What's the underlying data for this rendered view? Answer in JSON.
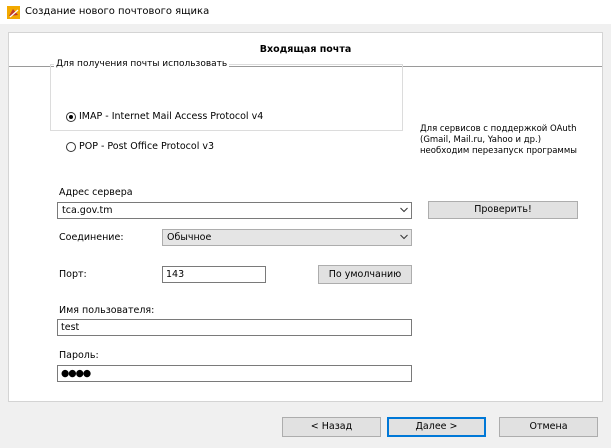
{
  "window": {
    "title": "Создание нового почтового ящика"
  },
  "page": {
    "title": "Входящая почта"
  },
  "protocol_group": {
    "legend": "Для получения почты использовать",
    "options": [
      {
        "label": "IMAP - Internet Mail Access Protocol v4",
        "selected": true
      },
      {
        "label": "POP  -  Post Office Protocol v3",
        "selected": false
      }
    ]
  },
  "oauth": {
    "note": "Для сервисов с поддержкой OAuth (Gmail, Mail.ru, Yahoo и др.) необходим перезапуск программы",
    "check_label": "Проверить!"
  },
  "server": {
    "label": "Адрес сервера",
    "value": "tca.gov.tm"
  },
  "connection": {
    "label": "Соединение:",
    "value": "Обычное"
  },
  "port": {
    "label": "Порт:",
    "value": "143",
    "default_label": "По умолчанию"
  },
  "username": {
    "label": "Имя пользователя:",
    "value": "test"
  },
  "password": {
    "label": "Пароль:",
    "value": "●●●●"
  },
  "footer": {
    "back_label": "< Назад",
    "next_label": "Далее >",
    "cancel_label": "Отмена"
  }
}
